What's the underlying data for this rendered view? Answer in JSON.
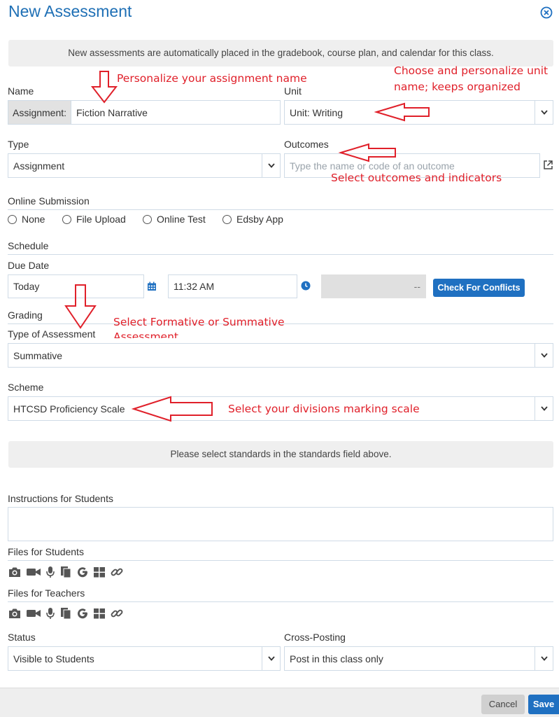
{
  "header": {
    "title": "New Assessment"
  },
  "banner": "New assessments are automatically placed in the gradebook, course plan, and calendar for this class.",
  "name": {
    "label": "Name",
    "prefix": "Assignment:",
    "value": "Fiction Narrative"
  },
  "unit": {
    "label": "Unit",
    "value": "Unit: Writing"
  },
  "type": {
    "label": "Type",
    "value": "Assignment"
  },
  "outcomes": {
    "label": "Outcomes",
    "placeholder": "Type the name or code of an outcome"
  },
  "online_submission": {
    "label": "Online Submission",
    "options": [
      "None",
      "File Upload",
      "Online Test",
      "Edsby App"
    ]
  },
  "schedule": {
    "label": "Schedule",
    "due_label": "Due Date",
    "date": "Today",
    "time": "11:32 AM",
    "disabled_value": "--",
    "conflicts_button": "Check For Conflicts"
  },
  "grading": {
    "label": "Grading",
    "assessment_type_label": "Type of Assessment",
    "assessment_type": "Summative",
    "scheme_label": "Scheme",
    "scheme": "HTCSD Proficiency Scale",
    "notice": "Please select standards in the standards field above."
  },
  "instructions": {
    "label": "Instructions for Students",
    "value": ""
  },
  "files_students": {
    "label": "Files for Students"
  },
  "files_teachers": {
    "label": "Files for Teachers"
  },
  "file_icons": [
    "camera-icon",
    "video-icon",
    "microphone-icon",
    "documents-icon",
    "google-icon",
    "windows-icon",
    "link-icon"
  ],
  "status": {
    "label": "Status",
    "value": "Visible to Students"
  },
  "cross_posting": {
    "label": "Cross-Posting",
    "value": "Post in this class only"
  },
  "footer": {
    "cancel": "Cancel",
    "save": "Save"
  },
  "annotations": {
    "name": "Personalize your assignment name",
    "unit_1": "Choose and personalize unit",
    "unit_2": "name; keeps organized",
    "outcomes": "Select outcomes and indicators",
    "grading_1": "Select Formative or Summative",
    "grading_2": "Assessment",
    "scheme": "Select your divisions marking scale"
  },
  "colors": {
    "accent": "#1f70c1",
    "annotation": "#e0202a",
    "border": "#cfdbe6"
  }
}
